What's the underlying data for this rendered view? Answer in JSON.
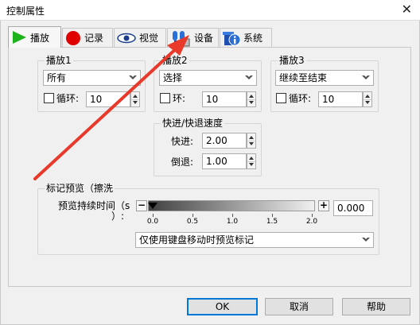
{
  "window": {
    "title": "控制属性",
    "close_glyph": "✕"
  },
  "tabs": [
    {
      "label": "播放",
      "icon": "play-icon"
    },
    {
      "label": "记录",
      "icon": "record-icon"
    },
    {
      "label": "视觉",
      "icon": "eye-icon"
    },
    {
      "label": "设备",
      "icon": "device-icon"
    },
    {
      "label": "系统",
      "icon": "system-info-icon"
    }
  ],
  "playback1": {
    "title": "播放1",
    "mode": "所有",
    "loop_label": "循环:",
    "loop_value": "10"
  },
  "playback2": {
    "title": "播放2",
    "mode": "选择",
    "loop_label": "环:",
    "loop_value": "10"
  },
  "playback3": {
    "title": "播放3",
    "mode": "继续至结束",
    "loop_label": "循环:",
    "loop_value": "10"
  },
  "speed": {
    "title": "快进/快退速度",
    "forward_label": "快进:",
    "forward_value": "2.00",
    "rewind_label": "倒退:",
    "rewind_value": "1.00"
  },
  "preview": {
    "title": "标记预览（擦洗",
    "duration_label": "预览持续时间（s",
    "duration_label_cont": "）:",
    "minus": "−",
    "plus": "+",
    "ticks": [
      "0.0",
      "0.5",
      "1.0",
      "1.5",
      "2.0"
    ],
    "slider_value": 0.0,
    "value": "0.000",
    "mode": "仅使用键盘移动时预览标记"
  },
  "buttons": {
    "ok": "OK",
    "cancel": "取消",
    "help": "帮助"
  },
  "colors": {
    "accent": "#0078d7",
    "annotation_arrow": "#e8392a",
    "play": "#1db31d",
    "record": "#e00000"
  }
}
